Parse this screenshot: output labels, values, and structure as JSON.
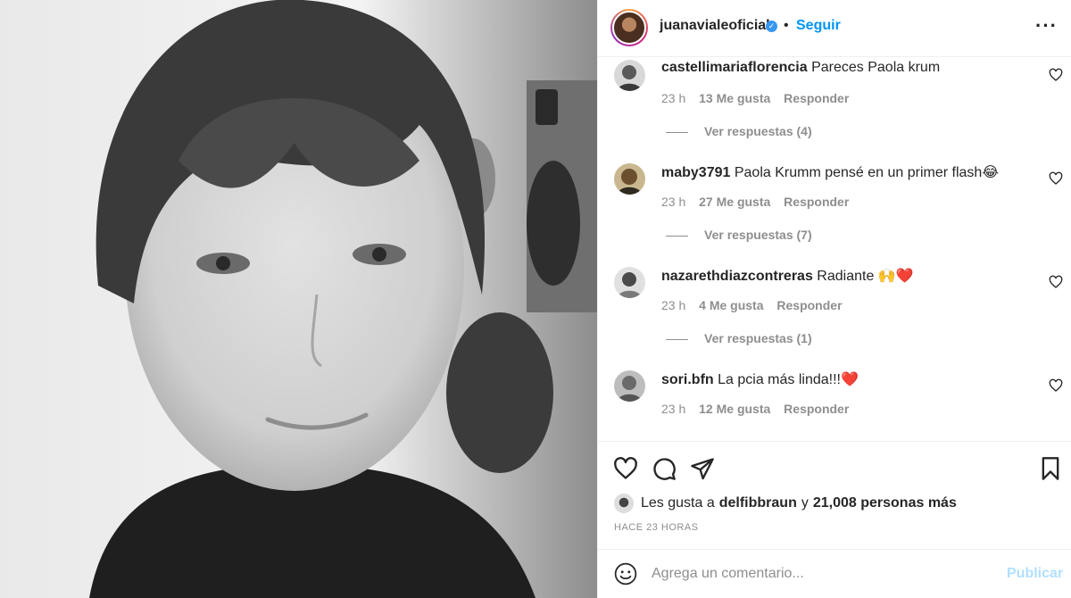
{
  "post": {
    "image_alt": "Selfie en blanco y negro"
  },
  "header": {
    "username": "juanavialeoficial",
    "verified_mark": "✓",
    "separator": "•",
    "follow_label": "Seguir",
    "more_label": "···"
  },
  "comments": [
    {
      "username": "castellimariaflorencia",
      "text": "Pareces Paola krum",
      "time": "23 h",
      "likes": "13 Me gusta",
      "reply_label": "Responder",
      "view_replies": "Ver respuestas (4)"
    },
    {
      "username": "maby3791",
      "text": "Paola Krumm pensé en un primer flash😂",
      "time": "23 h",
      "likes": "27 Me gusta",
      "reply_label": "Responder",
      "view_replies": "Ver respuestas (7)"
    },
    {
      "username": "nazarethdiazcontreras",
      "text": "Radiante 🙌❤️",
      "time": "23 h",
      "likes": "4 Me gusta",
      "reply_label": "Responder",
      "view_replies": "Ver respuestas (1)"
    },
    {
      "username": "sori.bfn",
      "text": "La pcia más linda!!!❤️",
      "time": "23 h",
      "likes": "12 Me gusta",
      "reply_label": "Responder"
    }
  ],
  "actions": {
    "icons": [
      "heart-icon",
      "comment-icon",
      "share-icon",
      "bookmark-icon"
    ]
  },
  "likes_summary": {
    "prefix": "Les gusta a",
    "user": "delfibbraun",
    "conjunction": "y",
    "others": "21,008 personas más"
  },
  "timestamp": "HACE 23 HORAS",
  "add_comment": {
    "placeholder": "Agrega un comentario...",
    "publish_label": "Publicar"
  },
  "colors": {
    "accent": "#0095f6",
    "publish_disabled": "#b2dffc",
    "text": "#262626",
    "muted": "#8e8e8e",
    "border": "#efefef"
  }
}
